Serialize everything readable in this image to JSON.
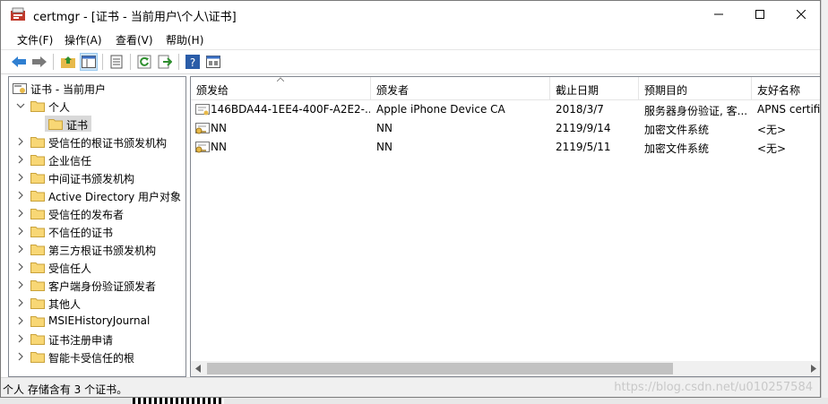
{
  "window": {
    "title": "certmgr - [证书 - 当前用户\\个人\\证书]"
  },
  "menu": [
    {
      "label": "文件(F)"
    },
    {
      "label": "操作(A)"
    },
    {
      "label": "查看(V)"
    },
    {
      "label": "帮助(H)"
    }
  ],
  "toolbar": {
    "icons": [
      "back-arrow-icon",
      "forward-arrow-icon",
      "up-folder-icon",
      "show-hide-tree-icon",
      "properties-icon",
      "refresh-icon",
      "export-list-icon",
      "help-icon",
      "view-icon"
    ]
  },
  "tree": {
    "items": [
      {
        "label": "证书 - 当前用户",
        "expander": "none",
        "icon": "certificates-root-icon"
      },
      {
        "label": "个人",
        "expander": "expanded",
        "icon": "folder-icon"
      },
      {
        "label": "证书",
        "expander": "none",
        "icon": "folder-icon",
        "selected": true
      },
      {
        "label": "受信任的根证书颁发机构",
        "expander": "collapsed",
        "icon": "folder-icon"
      },
      {
        "label": "企业信任",
        "expander": "collapsed",
        "icon": "folder-icon"
      },
      {
        "label": "中间证书颁发机构",
        "expander": "collapsed",
        "icon": "folder-icon"
      },
      {
        "label": "Active Directory 用户对象",
        "expander": "collapsed",
        "icon": "folder-icon"
      },
      {
        "label": "受信任的发布者",
        "expander": "collapsed",
        "icon": "folder-icon"
      },
      {
        "label": "不信任的证书",
        "expander": "collapsed",
        "icon": "folder-icon"
      },
      {
        "label": "第三方根证书颁发机构",
        "expander": "collapsed",
        "icon": "folder-icon"
      },
      {
        "label": "受信任人",
        "expander": "collapsed",
        "icon": "folder-icon"
      },
      {
        "label": "客户端身份验证颁发者",
        "expander": "collapsed",
        "icon": "folder-icon"
      },
      {
        "label": "其他人",
        "expander": "collapsed",
        "icon": "folder-icon"
      },
      {
        "label": "MSIEHistoryJournal",
        "expander": "collapsed",
        "icon": "folder-icon"
      },
      {
        "label": "证书注册申请",
        "expander": "collapsed",
        "icon": "folder-icon"
      },
      {
        "label": "智能卡受信任的根",
        "expander": "collapsed",
        "icon": "folder-icon"
      }
    ]
  },
  "list": {
    "columns": [
      {
        "label": "颁发给"
      },
      {
        "label": "颁发者"
      },
      {
        "label": "截止日期"
      },
      {
        "label": "预期目的"
      },
      {
        "label": "友好名称"
      }
    ],
    "rows": [
      {
        "issued_to": "146BDA44-1EE4-400F-A2E2-...",
        "issued_by": "Apple iPhone Device CA",
        "expires": "2018/3/7",
        "purpose": "服务器身份验证, 客...",
        "friendly": "APNS certificate",
        "icon": "certificate-icon"
      },
      {
        "issued_to": "NN",
        "issued_by": "NN",
        "expires": "2119/9/14",
        "purpose": "加密文件系统",
        "friendly": "<无>",
        "icon": "certificate-key-icon"
      },
      {
        "issued_to": "NN",
        "issued_by": "NN",
        "expires": "2119/5/11",
        "purpose": "加密文件系统",
        "friendly": "<无>",
        "icon": "certificate-key-icon"
      }
    ]
  },
  "status": {
    "text": "个人 存储含有 3 个证书。",
    "watermark": "https://blog.csdn.net/u010257584"
  },
  "colors": {
    "selection": "#d9d9d9",
    "toolbar_active": "#cce4f7",
    "folder": "#f8d775",
    "scroll_thumb": "#c2c2c2"
  }
}
